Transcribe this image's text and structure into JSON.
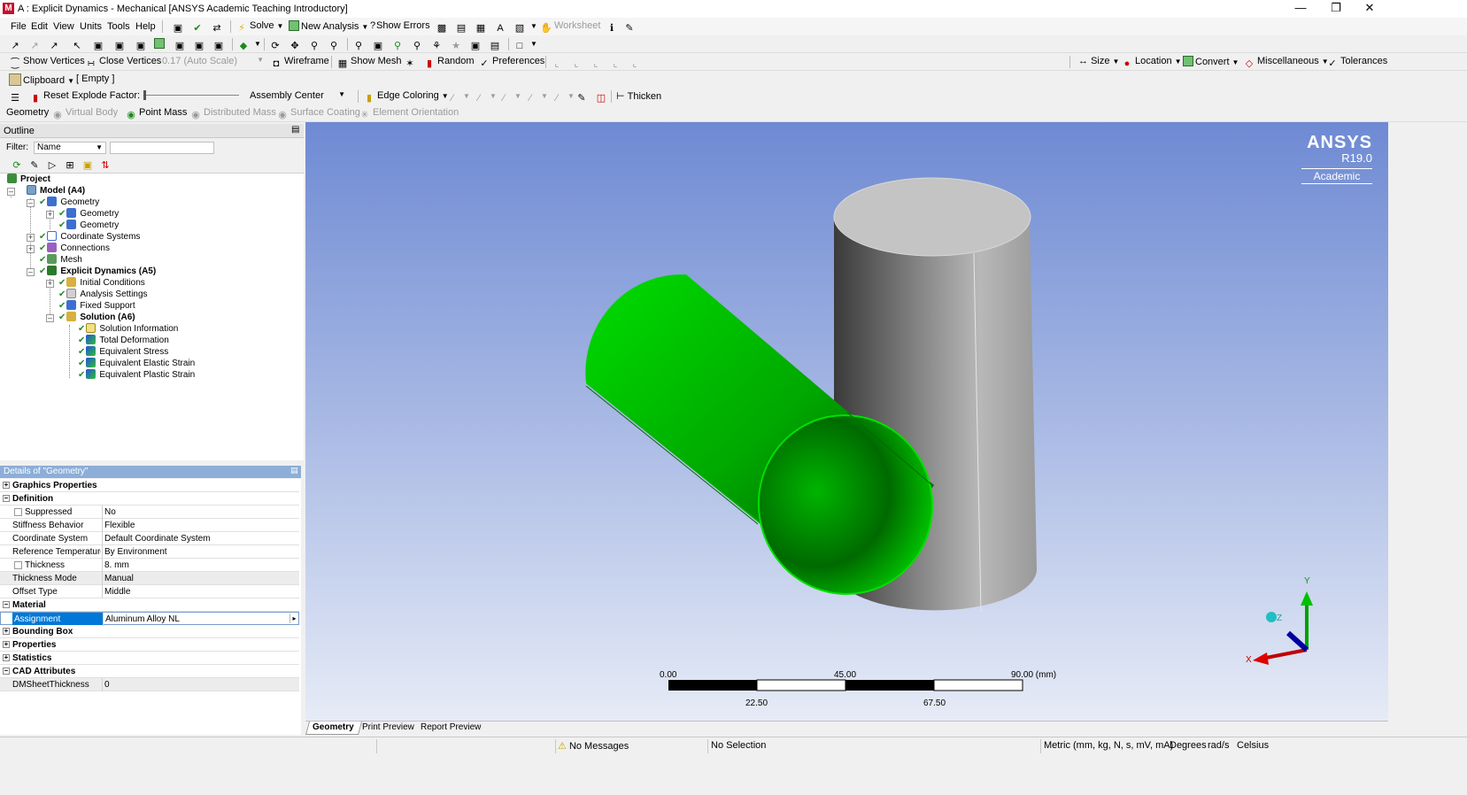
{
  "window": {
    "title": "A : Explicit Dynamics - Mechanical [ANSYS Academic Teaching Introductory]",
    "app_icon": "M"
  },
  "menu": [
    "File",
    "Edit",
    "View",
    "Units",
    "Tools",
    "Help"
  ],
  "toolbar1": {
    "solve": "Solve",
    "new_analysis": "New Analysis",
    "show_errors": "Show Errors",
    "worksheet": "Worksheet"
  },
  "toolbar3": {
    "show_vertices": "Show Vertices",
    "close_vertices": "Close Vertices",
    "scale_value": "0.17 (Auto Scale)",
    "wireframe": "Wireframe",
    "show_mesh": "Show Mesh",
    "random": "Random",
    "preferences": "Preferences",
    "size": "Size",
    "location": "Location",
    "convert": "Convert",
    "miscellaneous": "Miscellaneous",
    "tolerances": "Tolerances"
  },
  "toolbar4": {
    "clipboard": "Clipboard",
    "clipboard_state": "[ Empty ]"
  },
  "toolbar5": {
    "reset": "Reset",
    "explode_factor": "Explode Factor:",
    "assembly_center": "Assembly Center",
    "edge_coloring": "Edge Coloring",
    "thicken": "Thicken"
  },
  "toolbar6": {
    "geometry": "Geometry",
    "virtual_body": "Virtual Body",
    "point_mass": "Point Mass",
    "distributed_mass": "Distributed Mass",
    "surface_coating": "Surface Coating",
    "element_orientation": "Element Orientation"
  },
  "outline": {
    "title": "Outline",
    "filter_label": "Filter:",
    "filter_value": "Name",
    "nodes": [
      {
        "label": "Project",
        "bold": true
      },
      {
        "label": "Model (A4)",
        "bold": true
      },
      {
        "label": "Geometry",
        "bold": false
      },
      {
        "label": "Geometry",
        "bold": false
      },
      {
        "label": "Geometry",
        "bold": false
      },
      {
        "label": "Coordinate Systems",
        "bold": false
      },
      {
        "label": "Connections",
        "bold": false
      },
      {
        "label": "Mesh",
        "bold": false
      },
      {
        "label": "Explicit Dynamics (A5)",
        "bold": true
      },
      {
        "label": "Initial Conditions",
        "bold": false
      },
      {
        "label": "Analysis Settings",
        "bold": false
      },
      {
        "label": "Fixed Support",
        "bold": false
      },
      {
        "label": "Solution (A6)",
        "bold": true
      },
      {
        "label": "Solution Information",
        "bold": false
      },
      {
        "label": "Total Deformation",
        "bold": false
      },
      {
        "label": "Equivalent Stress",
        "bold": false
      },
      {
        "label": "Equivalent Elastic Strain",
        "bold": false
      },
      {
        "label": "Equivalent Plastic Strain",
        "bold": false
      }
    ]
  },
  "details": {
    "title": "Details of \"Geometry\"",
    "rows": [
      {
        "label": "Graphics Properties",
        "value": "",
        "category": true,
        "expanded": false
      },
      {
        "label": "Definition",
        "value": "",
        "category": true,
        "expanded": true
      },
      {
        "label": "Suppressed",
        "value": "No",
        "checkbox": true
      },
      {
        "label": "Stiffness Behavior",
        "value": "Flexible"
      },
      {
        "label": "Coordinate System",
        "value": "Default Coordinate System"
      },
      {
        "label": "Reference Temperature",
        "value": "By Environment"
      },
      {
        "label": "Thickness",
        "value": "8. mm",
        "checkbox": true
      },
      {
        "label": "Thickness Mode",
        "value": "Manual",
        "shaded": true
      },
      {
        "label": "Offset Type",
        "value": "Middle"
      },
      {
        "label": "Material",
        "value": "",
        "category": true,
        "expanded": true
      },
      {
        "label": "Assignment",
        "value": "Aluminum Alloy NL",
        "selected": true
      },
      {
        "label": "Bounding Box",
        "value": "",
        "category": true,
        "expanded": false
      },
      {
        "label": "Properties",
        "value": "",
        "category": true,
        "expanded": false
      },
      {
        "label": "Statistics",
        "value": "",
        "category": true,
        "expanded": false
      },
      {
        "label": "CAD Attributes",
        "value": "",
        "category": true,
        "expanded": true
      },
      {
        "label": "DMSheetThickness",
        "value": "0",
        "shaded": true
      }
    ]
  },
  "viewport": {
    "logo_brand": "ANSYS",
    "logo_version": "R19.0",
    "logo_edition": "Academic",
    "scale_top_labels": [
      "0.00",
      "45.00",
      "90.00 (mm)"
    ],
    "scale_bottom_labels": [
      "22.50",
      "67.50"
    ],
    "axis_x": "X",
    "axis_y": "Y",
    "axis_z": "Z",
    "colors": {
      "green_part": "#00c000",
      "gray_part": "#8c8c8c"
    }
  },
  "view_tabs": [
    "Geometry",
    "Print Preview",
    "Report Preview"
  ],
  "status": {
    "messages": "No Messages",
    "selection": "No Selection",
    "units": "Metric (mm, kg, N, s, mV, mA)",
    "angle": "Degrees",
    "rate": "rad/s",
    "temperature": "Celsius"
  }
}
